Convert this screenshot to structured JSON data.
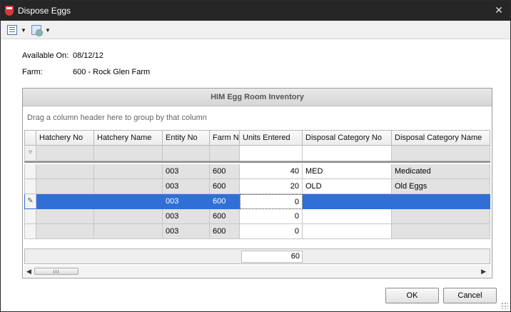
{
  "window": {
    "title": "Dispose Eggs",
    "close_glyph": "✕"
  },
  "toolbar": {
    "items": [
      {
        "icon": "layout-grid-icon",
        "caret": "▼"
      },
      {
        "icon": "export-icon",
        "caret": "▼"
      }
    ]
  },
  "info": {
    "available_label": "Available On:",
    "available_value": "08/12/12",
    "farm_label": "Farm:",
    "farm_value": "600 - Rock Glen Farm"
  },
  "grid": {
    "title": "HIM Egg Room Inventory",
    "group_prompt": "Drag a column header here to group by that column",
    "columns": [
      "Hatchery No",
      "Hatchery Name",
      "Entity No",
      "Farm No",
      "Units Entered",
      "Disposal Category No",
      "Disposal Category Name"
    ],
    "filter_indicator": "▿",
    "rows": [
      {
        "indicator": "",
        "hatchery_no": "",
        "hatchery_name": "",
        "entity_no": "003",
        "farm_no": "600",
        "units": "40",
        "category_no": "MED",
        "category_name": "Medicated"
      },
      {
        "indicator": "",
        "hatchery_no": "",
        "hatchery_name": "",
        "entity_no": "003",
        "farm_no": "600",
        "units": "20",
        "category_no": "OLD",
        "category_name": "Old Eggs"
      },
      {
        "indicator": "✎",
        "hatchery_no": "",
        "hatchery_name": "",
        "entity_no": "003",
        "farm_no": "600",
        "units": "0",
        "category_no": "",
        "category_name": ""
      },
      {
        "indicator": "",
        "hatchery_no": "",
        "hatchery_name": "",
        "entity_no": "003",
        "farm_no": "600",
        "units": "0",
        "category_no": "",
        "category_name": ""
      },
      {
        "indicator": "",
        "hatchery_no": "",
        "hatchery_name": "",
        "entity_no": "003",
        "farm_no": "600",
        "units": "0",
        "category_no": "",
        "category_name": ""
      }
    ],
    "total_units": "60",
    "scroll_left": "◀",
    "scroll_right": "▶"
  },
  "buttons": {
    "ok": "OK",
    "cancel": "Cancel"
  },
  "colors": {
    "selection": "#2f6fd6",
    "titlebar": "#262626"
  }
}
